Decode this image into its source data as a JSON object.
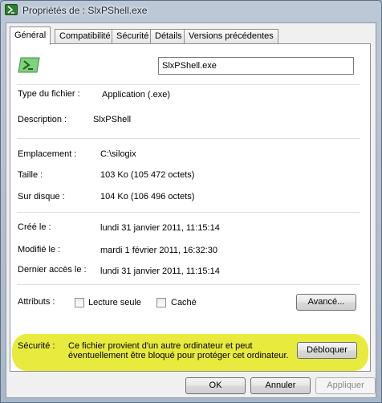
{
  "window": {
    "title": "Propriétés de : SlxPShell.exe"
  },
  "tabs": [
    {
      "label": "Général",
      "active": true
    },
    {
      "label": "Compatibilité"
    },
    {
      "label": "Sécurité"
    },
    {
      "label": "Détails"
    },
    {
      "label": "Versions précédentes"
    }
  ],
  "general": {
    "file_name": "SlxPShell.exe",
    "file_type_label": "Type du fichier :",
    "file_type_value": "Application (.exe)",
    "description_label": "Description :",
    "description_value": "SlxPShell",
    "location_label": "Emplacement :",
    "location_value": "C:\\silogix",
    "size_label": "Taille :",
    "size_value": "103 Ko (105 472 octets)",
    "size_on_disk_label": "Sur disque :",
    "size_on_disk_value": "104 Ko (106 496 octets)",
    "created_label": "Créé le :",
    "created_value": "lundi 31 janvier 2011, 11:15:14",
    "modified_label": "Modifié le :",
    "modified_value": "mardi 1 février 2011, 16:32:30",
    "accessed_label": "Dernier accès le :",
    "accessed_value": "lundi 31 janvier 2011, 11:15:14",
    "attributes_label": "Attributs :",
    "readonly_label": "Lecture seule",
    "hidden_label": "Caché",
    "advanced_button": "Avancé...",
    "security_label": "Sécurité :",
    "security_text": "Ce fichier provient d'un autre ordinateur et peut éventuellement être bloqué pour protéger cet ordinateur.",
    "unblock_button": "Débloquer"
  },
  "footer": {
    "ok": "OK",
    "cancel": "Annuler",
    "apply": "Appliquer"
  },
  "colors": {
    "highlight": "#e8ea3e",
    "app_icon": "#2f7d2f"
  },
  "icons": {
    "title_icon": "powershell-icon",
    "app_icon": "powershell-icon"
  }
}
